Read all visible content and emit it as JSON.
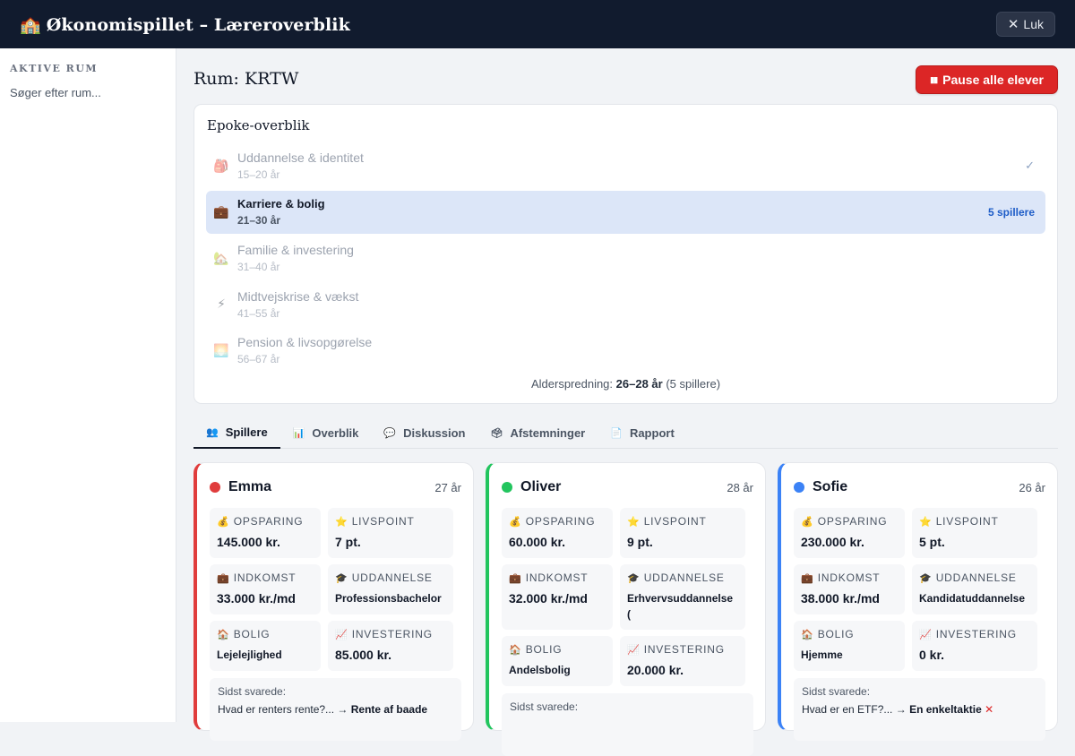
{
  "header": {
    "icon": "🏫",
    "title": "Økonomispillet – Læreroverblik",
    "close_label": "Luk"
  },
  "sidebar": {
    "heading": "AKTIVE RUM",
    "status": "Søger efter rum..."
  },
  "main": {
    "room_title": "Rum: KRTW",
    "pause_label": "Pause alle elever"
  },
  "epochs": {
    "title": "Epoke-overblik",
    "items": [
      {
        "icon": "🎒",
        "name": "Uddannelse & identitet",
        "age": "15–20 år",
        "check": "✓"
      },
      {
        "icon": "💼",
        "name": "Karriere & bolig",
        "age": "21–30 år",
        "count": "5 spillere"
      },
      {
        "icon": "🏡",
        "name": "Familie & investering",
        "age": "31–40 år"
      },
      {
        "icon": "⚡",
        "name": "Midtvejskrise & vækst",
        "age": "41–55 år"
      },
      {
        "icon": "🌅",
        "name": "Pension & livsopgørelse",
        "age": "56–67 år"
      }
    ],
    "spread_prefix": "Alderspredning:",
    "spread_value": "26–28 år",
    "spread_suffix": "(5 spillere)"
  },
  "tabs": [
    {
      "icon": "👥",
      "label": "Spillere"
    },
    {
      "icon": "📊",
      "label": "Overblik"
    },
    {
      "icon": "💬",
      "label": "Diskussion"
    },
    {
      "icon": "🗳",
      "label": "Afstemninger"
    },
    {
      "icon": "📄",
      "label": "Rapport"
    }
  ],
  "labels": {
    "savings": "OPSPARING",
    "lifepoints": "LIVSPOINT",
    "income": "INDKOMST",
    "education": "UDDANNELSE",
    "housing": "BOLIG",
    "investment": "INVESTERING",
    "last_answered": "Sidst svarede:"
  },
  "icons": {
    "savings": "💰",
    "lifepoints": "⭐",
    "income": "💼",
    "education": "🎓",
    "housing": "🏠",
    "investment": "📈"
  },
  "players": [
    {
      "name": "Emma",
      "age": "27 år",
      "color": "#e03c3c",
      "savings": "145.000 kr.",
      "lifepoints": "7 pt.",
      "income": "33.000 kr./md",
      "education": "Professionsbachelor",
      "housing": "Lejelejlighed",
      "investment": "85.000 kr.",
      "last_question": "Hvad er renters rente?... →",
      "last_answer": "Rente af baade"
    },
    {
      "name": "Oliver",
      "age": "28 år",
      "color": "#22c55e",
      "savings": "60.000 kr.",
      "lifepoints": "9 pt.",
      "income": "32.000 kr./md",
      "education": "Erhvervsuddannelse (",
      "housing": "Andelsbolig",
      "investment": "20.000 kr.",
      "last_question": "",
      "last_answer": ""
    },
    {
      "name": "Sofie",
      "age": "26 år",
      "color": "#3b82f6",
      "savings": "230.000 kr.",
      "lifepoints": "5 pt.",
      "income": "38.000 kr./md",
      "education": "Kandidatuddannelse",
      "housing": "Hjemme",
      "investment": "0 kr.",
      "last_question": "Hvad er en ETF?... →",
      "last_answer": "En enkeltaktie",
      "last_mark": "✕"
    }
  ]
}
